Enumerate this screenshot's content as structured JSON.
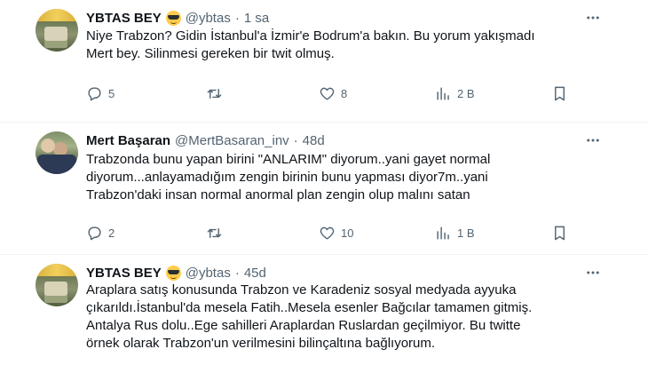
{
  "tweets": [
    {
      "name": "YBTAS BEY",
      "handle": "@ybtas",
      "sep": "·",
      "time": "1 sa",
      "emoji": "smiling-face-with-sunglasses",
      "text_lines": [
        "Niye Trabzon? Gidin İstanbul'a İzmir'e Bodrum'a bakın. Bu yorum yakışmadı",
        "Mert bey. Silinmesi gereken bir twit olmuş."
      ],
      "replies": "5",
      "retweets": "",
      "likes": "8",
      "views": "2 B"
    },
    {
      "name": "Mert Başaran",
      "handle": "@MertBasaran_inv",
      "sep": "·",
      "time": "48d",
      "text_lines": [
        "Trabzonda bunu yapan birini \"ANLARIM\" diyorum..yani gayet normal",
        "diyorum...anlayamadığım zengin birinin bunu yapması diyor7m..yani",
        "Trabzon'daki insan normal anormal plan zengin olup malını satan"
      ],
      "replies": "2",
      "retweets": "",
      "likes": "10",
      "views": "1 B"
    },
    {
      "name": "YBTAS BEY",
      "handle": "@ybtas",
      "sep": "·",
      "time": "45d",
      "emoji": "smiling-face-with-sunglasses",
      "text_lines": [
        "Araplara satış konusunda Trabzon ve Karadeniz sosyal medyada ayyuka",
        "çıkarıldı.İstanbul'da mesela Fatih..Mesela esenler Bağcılar tamamen gitmiş.",
        "Antalya Rus dolu..Ege sahilleri Araplardan Ruslardan geçilmiyor. Bu twitte",
        "örnek olarak Trabzon'un verilmesini bilinçaltına bağlıyorum."
      ]
    }
  ],
  "colors": {
    "text": "#0f1419",
    "secondary": "#536471",
    "divider": "#eff3f4",
    "background": "#ffffff"
  }
}
